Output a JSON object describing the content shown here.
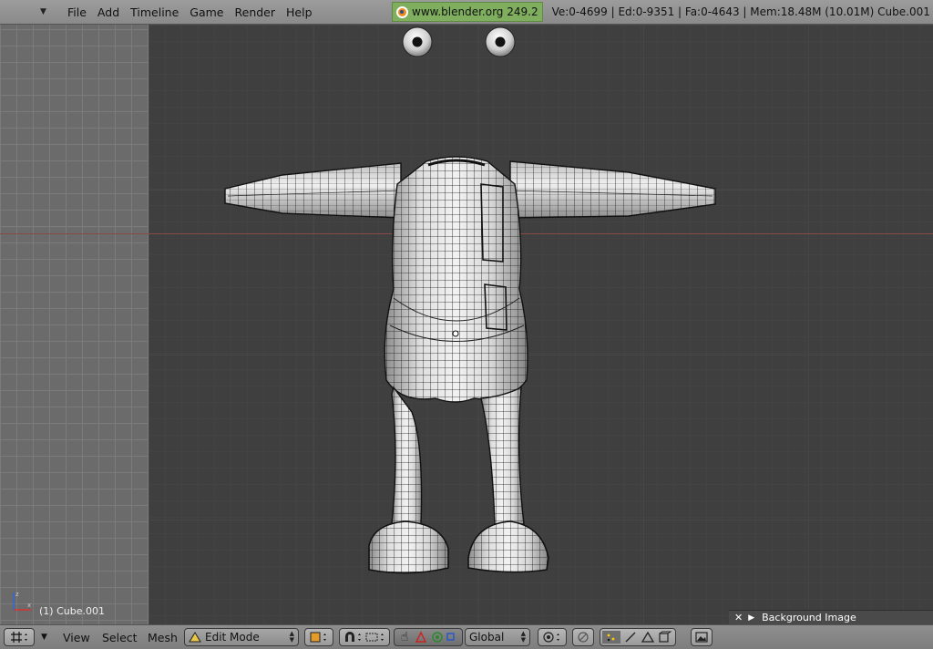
{
  "top_menu": {
    "items": [
      "File",
      "Add",
      "Timeline",
      "Game",
      "Render",
      "Help"
    ],
    "site": "www.blender.org 249.2",
    "stats": "Ve:0-4699 | Ed:0-9351 | Fa:0-4643 | Mem:18.48M (10.01M) Cube.001"
  },
  "viewport": {
    "object_label": "(1) Cube.001",
    "background_panel_label": "Background Image"
  },
  "bottom_bar": {
    "view_label": "View",
    "select_label": "Select",
    "mesh_label": "Mesh",
    "mode_value": "Edit Mode",
    "orientation_value": "Global"
  },
  "colors": {
    "viewport_bg": "#3f3f3f",
    "header_bg": "#8e8e8e",
    "site_badge": "#7fae5f",
    "mesh_fill": "#dcdcdc",
    "mesh_wire": "#111111"
  }
}
